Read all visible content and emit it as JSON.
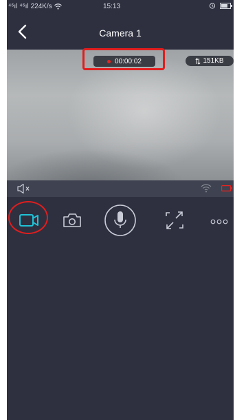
{
  "status_bar": {
    "signal_text": "⁴⁶ıl ⁴⁶ıl",
    "speed": "224K/s",
    "time": "15:13"
  },
  "header": {
    "title": "Camera 1"
  },
  "video": {
    "recording_timer": "00:00:02",
    "data_usage": "151KB"
  },
  "toolbar": {
    "items": [
      "video-record",
      "snapshot",
      "microphone",
      "fullscreen",
      "more"
    ],
    "active_item": "video-record"
  },
  "colors": {
    "background": "#2e3040",
    "accent": "#1fc3d6",
    "recording_dot": "#e8231f",
    "highlight": "#e21d1d",
    "battery_low": "#e8231f"
  },
  "icons": {
    "back": "chevron-left-icon",
    "mute": "speaker-muted-icon",
    "wifi": "wifi-icon",
    "battery": "battery-low-icon",
    "record": "video-camera-icon",
    "snapshot": "camera-icon",
    "mic": "microphone-icon",
    "fullscreen": "expand-icon",
    "more": "more-dots-icon"
  }
}
